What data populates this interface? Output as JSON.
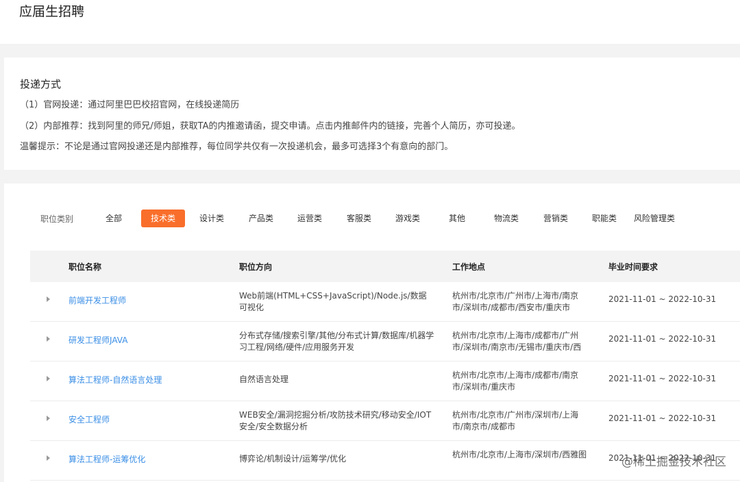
{
  "page": {
    "title": "应届生招聘"
  },
  "delivery": {
    "title": "投递方式",
    "line1": "（1）官网投递：通过阿里巴巴校招官网，在线投递简历",
    "line2": "（2）内部推荐：找到阿里的师兄/师姐，获取TA的内推邀请函，提交申请。点击内推邮件内的链接，完善个人简历，亦可投递。",
    "tip": "温馨提示：不论是通过官网投递还是内部推荐，每位同学共仅有一次投递机会，最多可选择3个有意向的部门。"
  },
  "filters": {
    "label": "职位类别",
    "items": [
      "全部",
      "技术类",
      "设计类",
      "产品类",
      "运营类",
      "客服类",
      "游戏类",
      "其他",
      "物流类",
      "营销类",
      "职能类",
      "风险管理类"
    ],
    "active_index": 1
  },
  "table": {
    "headers": [
      "职位名称",
      "职位方向",
      "工作地点",
      "毕业时间要求"
    ],
    "rows": [
      {
        "name": "前端开发工程师",
        "direction": "Web前端(HTML+CSS+JavaScript)/Node.js/数据可视化",
        "location": "杭州市/北京市/广州市/上海市/南京市/深圳市/成都市/西安市/重庆市",
        "time": "2021-11-01 ~ 2022-10-31"
      },
      {
        "name": "研发工程师JAVA",
        "direction": "分布式存储/搜索引擎/其他/分布式计算/数据库/机器学习工程/网络/硬件/应用服务开发",
        "location": "杭州市/北京市/上海市/成都市/广州市/深圳市/南京市/无锡市/重庆市/西",
        "time": "2021-11-01 ~ 2022-10-31"
      },
      {
        "name": "算法工程师-自然语言处理",
        "direction": "自然语言处理",
        "location": "杭州市/北京市/上海市/成都市/南京市/深圳市/重庆市",
        "time": "2021-11-01 ~ 2022-10-31"
      },
      {
        "name": "安全工程师",
        "direction": "WEB安全/漏洞挖掘分析/攻防技术研究/移动安全/IOT安全/安全数据分析",
        "location": "杭州市/北京市/广州市/深圳市/上海市/南京市/成都市",
        "time": "2021-11-01 ~ 2022-10-31"
      },
      {
        "name": "算法工程师-运筹优化",
        "direction": "博弈论/机制设计/运筹学/优化",
        "location": "杭州市/北京市/上海市/深圳市/西雅图",
        "time": "2021-11-01 ~ 2022-10-31"
      }
    ]
  },
  "watermark": "@稀土掘金技术社区"
}
